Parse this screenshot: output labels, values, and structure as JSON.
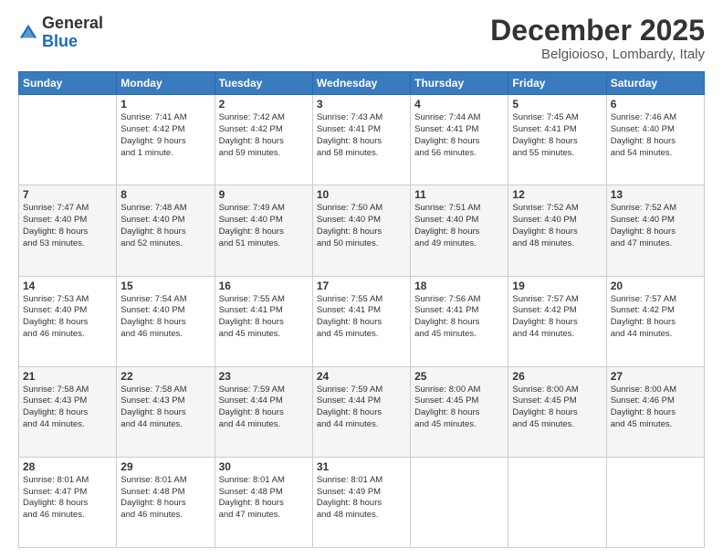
{
  "logo": {
    "general": "General",
    "blue": "Blue"
  },
  "header": {
    "month": "December 2025",
    "location": "Belgioioso, Lombardy, Italy"
  },
  "weekdays": [
    "Sunday",
    "Monday",
    "Tuesday",
    "Wednesday",
    "Thursday",
    "Friday",
    "Saturday"
  ],
  "weeks": [
    [
      {
        "day": "",
        "info": ""
      },
      {
        "day": "1",
        "info": "Sunrise: 7:41 AM\nSunset: 4:42 PM\nDaylight: 9 hours\nand 1 minute."
      },
      {
        "day": "2",
        "info": "Sunrise: 7:42 AM\nSunset: 4:42 PM\nDaylight: 8 hours\nand 59 minutes."
      },
      {
        "day": "3",
        "info": "Sunrise: 7:43 AM\nSunset: 4:41 PM\nDaylight: 8 hours\nand 58 minutes."
      },
      {
        "day": "4",
        "info": "Sunrise: 7:44 AM\nSunset: 4:41 PM\nDaylight: 8 hours\nand 56 minutes."
      },
      {
        "day": "5",
        "info": "Sunrise: 7:45 AM\nSunset: 4:41 PM\nDaylight: 8 hours\nand 55 minutes."
      },
      {
        "day": "6",
        "info": "Sunrise: 7:46 AM\nSunset: 4:40 PM\nDaylight: 8 hours\nand 54 minutes."
      }
    ],
    [
      {
        "day": "7",
        "info": "Sunrise: 7:47 AM\nSunset: 4:40 PM\nDaylight: 8 hours\nand 53 minutes."
      },
      {
        "day": "8",
        "info": "Sunrise: 7:48 AM\nSunset: 4:40 PM\nDaylight: 8 hours\nand 52 minutes."
      },
      {
        "day": "9",
        "info": "Sunrise: 7:49 AM\nSunset: 4:40 PM\nDaylight: 8 hours\nand 51 minutes."
      },
      {
        "day": "10",
        "info": "Sunrise: 7:50 AM\nSunset: 4:40 PM\nDaylight: 8 hours\nand 50 minutes."
      },
      {
        "day": "11",
        "info": "Sunrise: 7:51 AM\nSunset: 4:40 PM\nDaylight: 8 hours\nand 49 minutes."
      },
      {
        "day": "12",
        "info": "Sunrise: 7:52 AM\nSunset: 4:40 PM\nDaylight: 8 hours\nand 48 minutes."
      },
      {
        "day": "13",
        "info": "Sunrise: 7:52 AM\nSunset: 4:40 PM\nDaylight: 8 hours\nand 47 minutes."
      }
    ],
    [
      {
        "day": "14",
        "info": "Sunrise: 7:53 AM\nSunset: 4:40 PM\nDaylight: 8 hours\nand 46 minutes."
      },
      {
        "day": "15",
        "info": "Sunrise: 7:54 AM\nSunset: 4:40 PM\nDaylight: 8 hours\nand 46 minutes."
      },
      {
        "day": "16",
        "info": "Sunrise: 7:55 AM\nSunset: 4:41 PM\nDaylight: 8 hours\nand 45 minutes."
      },
      {
        "day": "17",
        "info": "Sunrise: 7:55 AM\nSunset: 4:41 PM\nDaylight: 8 hours\nand 45 minutes."
      },
      {
        "day": "18",
        "info": "Sunrise: 7:56 AM\nSunset: 4:41 PM\nDaylight: 8 hours\nand 45 minutes."
      },
      {
        "day": "19",
        "info": "Sunrise: 7:57 AM\nSunset: 4:42 PM\nDaylight: 8 hours\nand 44 minutes."
      },
      {
        "day": "20",
        "info": "Sunrise: 7:57 AM\nSunset: 4:42 PM\nDaylight: 8 hours\nand 44 minutes."
      }
    ],
    [
      {
        "day": "21",
        "info": "Sunrise: 7:58 AM\nSunset: 4:43 PM\nDaylight: 8 hours\nand 44 minutes."
      },
      {
        "day": "22",
        "info": "Sunrise: 7:58 AM\nSunset: 4:43 PM\nDaylight: 8 hours\nand 44 minutes."
      },
      {
        "day": "23",
        "info": "Sunrise: 7:59 AM\nSunset: 4:44 PM\nDaylight: 8 hours\nand 44 minutes."
      },
      {
        "day": "24",
        "info": "Sunrise: 7:59 AM\nSunset: 4:44 PM\nDaylight: 8 hours\nand 44 minutes."
      },
      {
        "day": "25",
        "info": "Sunrise: 8:00 AM\nSunset: 4:45 PM\nDaylight: 8 hours\nand 45 minutes."
      },
      {
        "day": "26",
        "info": "Sunrise: 8:00 AM\nSunset: 4:45 PM\nDaylight: 8 hours\nand 45 minutes."
      },
      {
        "day": "27",
        "info": "Sunrise: 8:00 AM\nSunset: 4:46 PM\nDaylight: 8 hours\nand 45 minutes."
      }
    ],
    [
      {
        "day": "28",
        "info": "Sunrise: 8:01 AM\nSunset: 4:47 PM\nDaylight: 8 hours\nand 46 minutes."
      },
      {
        "day": "29",
        "info": "Sunrise: 8:01 AM\nSunset: 4:48 PM\nDaylight: 8 hours\nand 46 minutes."
      },
      {
        "day": "30",
        "info": "Sunrise: 8:01 AM\nSunset: 4:48 PM\nDaylight: 8 hours\nand 47 minutes."
      },
      {
        "day": "31",
        "info": "Sunrise: 8:01 AM\nSunset: 4:49 PM\nDaylight: 8 hours\nand 48 minutes."
      },
      {
        "day": "",
        "info": ""
      },
      {
        "day": "",
        "info": ""
      },
      {
        "day": "",
        "info": ""
      }
    ]
  ]
}
